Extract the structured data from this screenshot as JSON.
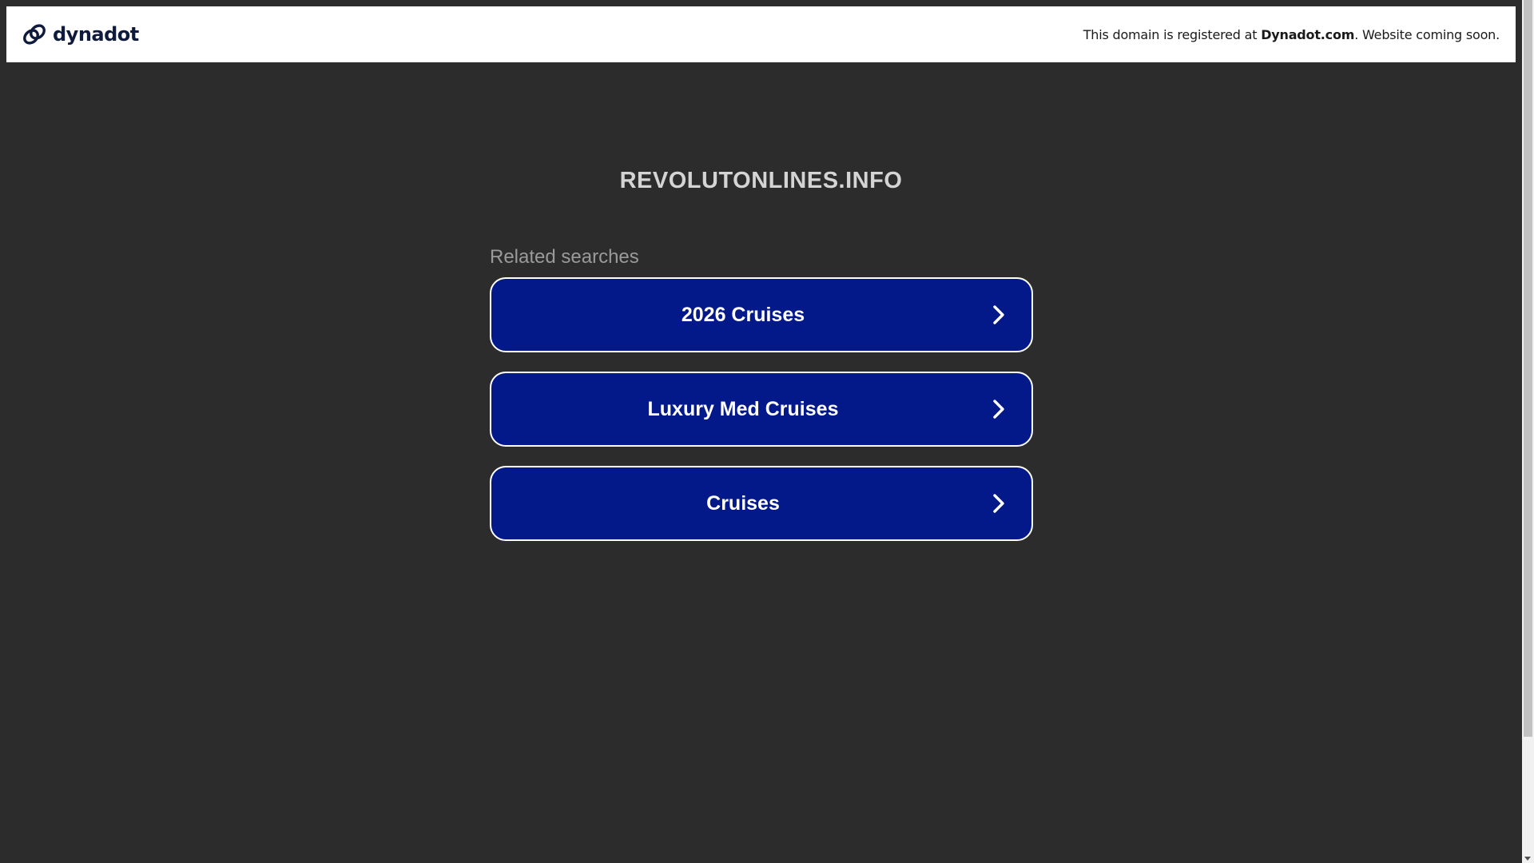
{
  "header": {
    "brand_name": "dynadot",
    "notice_prefix": "This domain is registered at ",
    "notice_link": "Dynadot.com",
    "notice_suffix": ". Website coming soon."
  },
  "main": {
    "domain_name": "REVOLUTONLINES.INFO",
    "related_heading": "Related searches",
    "related_searches": [
      {
        "label": "2026 Cruises"
      },
      {
        "label": "Luxury Med Cruises"
      },
      {
        "label": "Cruises"
      }
    ]
  },
  "colors": {
    "background": "#2c2c2c",
    "header_bg": "#ffffff",
    "button_bg": "#03198a",
    "brand_text": "#0f1b3d"
  },
  "icons": {
    "brand": "dynadot-logo-icon",
    "chevron": "chevron-right-icon"
  }
}
